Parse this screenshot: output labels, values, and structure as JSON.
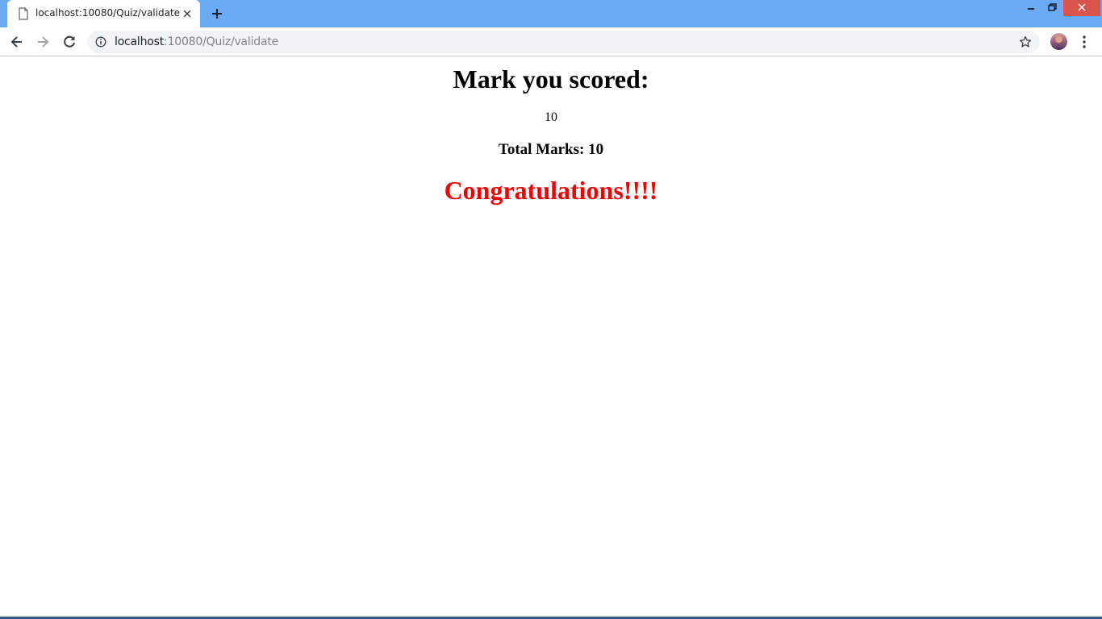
{
  "browser": {
    "tab": {
      "title": "localhost:10080/Quiz/validate"
    },
    "address_bar": {
      "host": "localhost",
      "path": ":10080/Quiz/validate"
    },
    "icons": {
      "favicon": "page-icon",
      "tab_close": "close-icon",
      "new_tab": "plus-icon",
      "back": "arrow-left-icon",
      "forward": "arrow-right-icon",
      "reload": "reload-icon",
      "site_info": "info-icon",
      "bookmark": "star-icon",
      "menu": "kebab-menu-icon"
    }
  },
  "page": {
    "heading": "Mark you scored:",
    "score": "10",
    "total_marks": "Total Marks: 10",
    "message": "Congratulations!!!!"
  },
  "colors": {
    "tab_strip": "#6aaaf4",
    "message": "#ee0000"
  }
}
